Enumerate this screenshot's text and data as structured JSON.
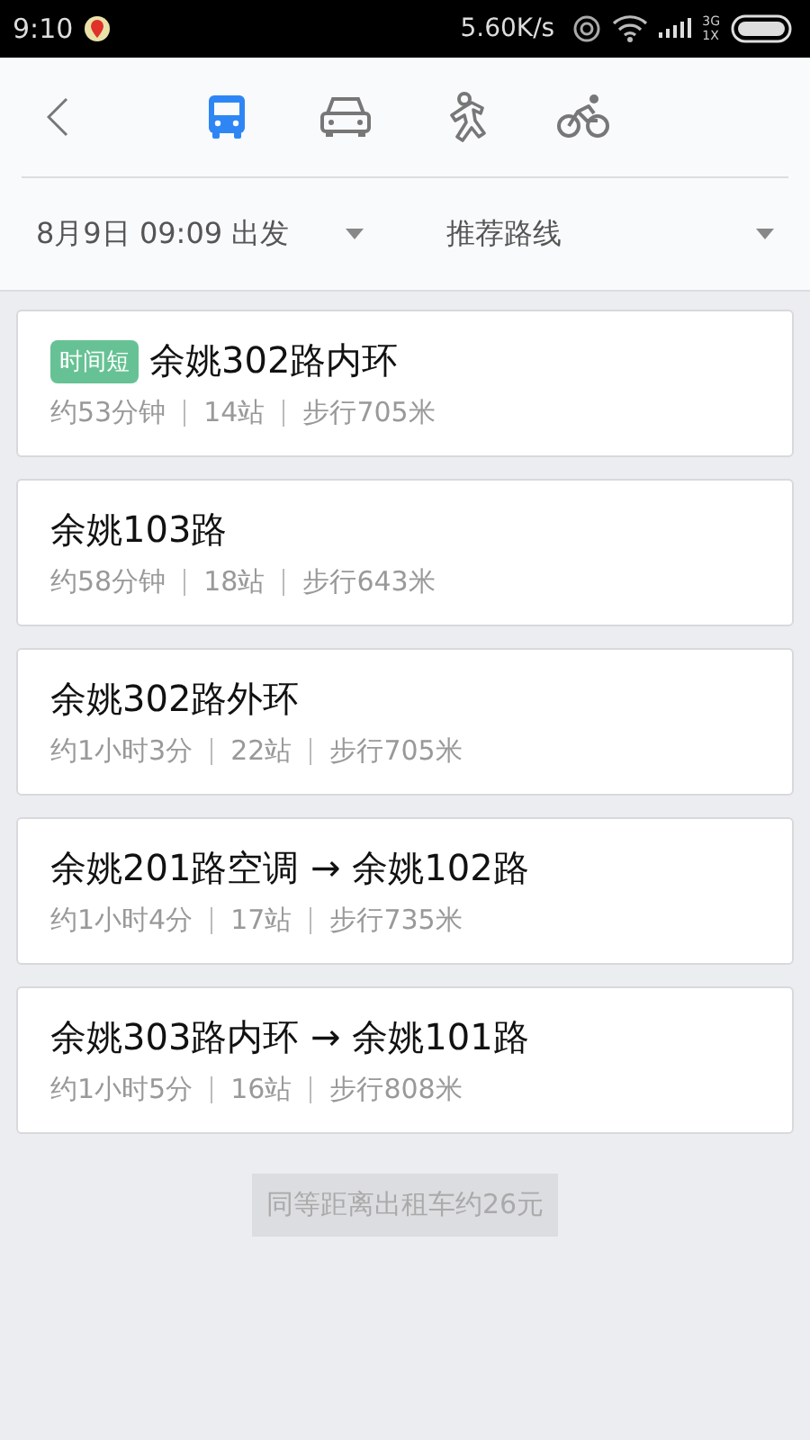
{
  "status_bar": {
    "time": "9:10",
    "speed": "5.60K/s",
    "network": [
      "3G",
      "1X"
    ]
  },
  "modes": [
    {
      "kind": "bus",
      "selected": true
    },
    {
      "kind": "car",
      "selected": false
    },
    {
      "kind": "walk",
      "selected": false
    },
    {
      "kind": "bike",
      "selected": false
    }
  ],
  "filters": [
    {
      "label": "8月9日 09:09 出发"
    },
    {
      "label": "推荐路线"
    }
  ],
  "routes": [
    {
      "tag": "时间短",
      "title": "余姚302路内环",
      "meta": [
        "约53分钟",
        "14站",
        "步行705米"
      ]
    },
    {
      "title": "余姚103路",
      "meta": [
        "约58分钟",
        "18站",
        "步行643米"
      ]
    },
    {
      "title": "余姚302路外环",
      "meta": [
        "约1小时3分",
        "22站",
        "步行705米"
      ]
    },
    {
      "title": "余姚201路空调 → 余姚102路",
      "meta": [
        "约1小时4分",
        "17站",
        "步行735米"
      ]
    },
    {
      "title": "余姚303路内环 → 余姚101路",
      "meta": [
        "约1小时5分",
        "16站",
        "步行808米"
      ]
    }
  ],
  "taxi_note": "同等距离出租车约26元"
}
